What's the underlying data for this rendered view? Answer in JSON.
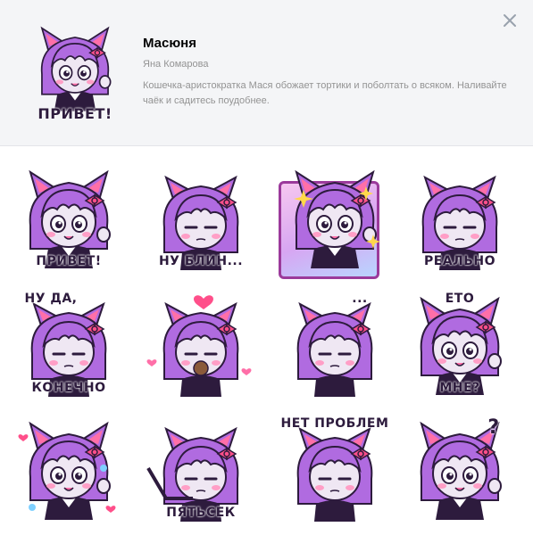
{
  "header": {
    "title": "Масюня",
    "author": "Яна Комарова",
    "description": "Кошечка-аристократка Мася обожает тортики и поболтать о всяком. Наливайте чаёк и садитесь поудобнее.",
    "cover_caption": "ПРИВЕТ!",
    "close_icon": "close-icon"
  },
  "stickers": [
    {
      "caption": "ПРИВЕТ!"
    },
    {
      "caption": "НУ БЛИН..."
    },
    {
      "caption": ""
    },
    {
      "caption": "РЕАЛЬНО"
    },
    {
      "caption": "НУ ДА,"
    },
    {
      "caption": "КОНЕЧНО"
    },
    {
      "caption": ""
    },
    {
      "caption": "..."
    },
    {
      "caption": "ЕТО"
    },
    {
      "caption": "МНЕ?"
    },
    {
      "caption": ""
    },
    {
      "caption": "ПЯТЬСЕК"
    },
    {
      "caption": "НЕТ ПРОБЛЕМ"
    },
    {
      "caption": "?"
    }
  ],
  "colors": {
    "hair": "#b06be0",
    "hair_dark": "#7f3fb5",
    "ears": "#ff6fa8",
    "skin": "#efe7f3",
    "outline": "#2d1b3d",
    "bow": "#ff4f8a"
  }
}
